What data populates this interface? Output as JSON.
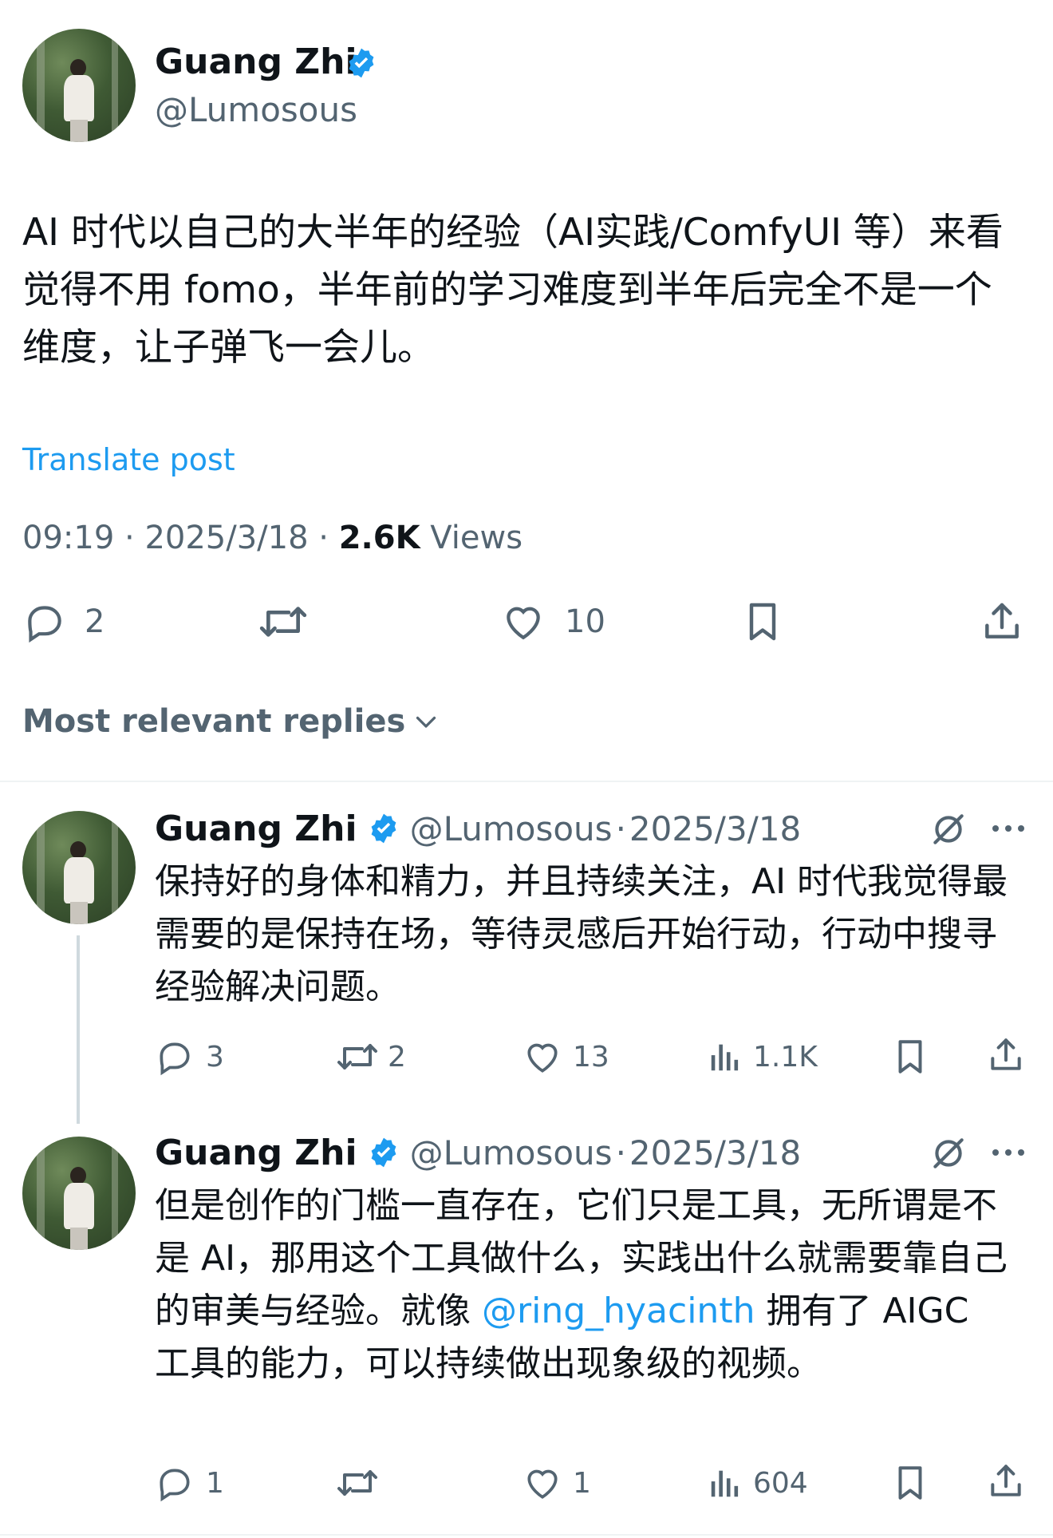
{
  "main_post": {
    "author_name": "Guang Zhi",
    "author_handle": "@Lumosous",
    "text": "AI 时代以自己的大半年的经验（AI实践/ComfyUI 等）来看觉得不用 fomo，半年前的学习难度到半年后完全不是一个维度，让子弹飞一会儿。",
    "translate_label": "Translate post",
    "time": "09:19",
    "date": "2025/3/18",
    "views_count": "2.6K",
    "views_label": "Views",
    "reply_count": "2",
    "like_count": "10"
  },
  "replies_filter": {
    "label": "Most relevant replies"
  },
  "replies": [
    {
      "author_name": "Guang Zhi",
      "author_handle": "@Lumosous",
      "date": "2025/3/18",
      "text": "保持好的身体和精力，并且持续关注，AI 时代我觉得最需要的是保持在场，等待灵感后开始行动，行动中搜寻经验解决问题。",
      "reply_count": "3",
      "repost_count": "2",
      "like_count": "13",
      "views_count": "1.1K"
    },
    {
      "author_name": "Guang Zhi",
      "author_handle": "@Lumosous",
      "date": "2025/3/18",
      "text_before_mention": "但是创作的门槛一直存在，它们只是工具，无所谓是不是 AI，那用这个工具做什么，实践出什么就需要靠自己的审美与经验。就像 ",
      "mention": "@ring_hyacinth",
      "text_after_mention": " 拥有了 AIGC 工具的能力，可以持续做出现象级的视频。",
      "reply_count": "1",
      "like_count": "1",
      "views_count": "604"
    }
  ],
  "colors": {
    "accent": "#1d9bf0",
    "text_primary": "#0f1419",
    "text_secondary": "#536471",
    "divider": "#eff3f4"
  }
}
